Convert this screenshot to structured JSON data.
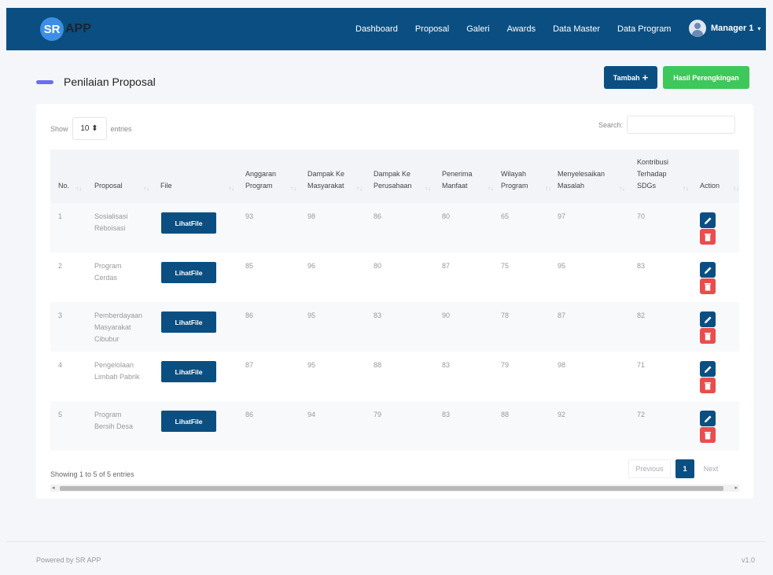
{
  "brand": {
    "logo": "SR",
    "text": "APP"
  },
  "nav": {
    "links": [
      "Dashboard",
      "Proposal",
      "Galeri",
      "Awards",
      "Data Master",
      "Data Program"
    ],
    "user": "Manager 1",
    "caret": "▾"
  },
  "header": {
    "title": "Penilaian Proposal",
    "add_label": "Tambah",
    "add_icon": "+",
    "ranking_label": "Hasil Perengkingan"
  },
  "table_controls": {
    "show_label": "Show",
    "entries_value": "10 ⬍",
    "entries_label": "entries",
    "search_label": "Search:"
  },
  "columns": [
    [
      "No."
    ],
    [
      "Proposal"
    ],
    [
      "File"
    ],
    [
      "Anggaran",
      "Program"
    ],
    [
      "Dampak Ke",
      "Masyarakat"
    ],
    [
      "Dampak Ke",
      "Perusahaan"
    ],
    [
      "Penerima",
      "Manfaat"
    ],
    [
      "Wilayah",
      "Program"
    ],
    [
      "Menyelesaikan",
      "Masalah"
    ],
    [
      "Kontribusi",
      "Terhadap",
      "SDGs"
    ],
    [
      "Action"
    ]
  ],
  "sort_icon": "↑↓",
  "file_button_label": "LihatFile",
  "rows": [
    {
      "no": "1",
      "proposal": [
        "Sosialisasi",
        "Reboisasi"
      ],
      "scores": [
        "93",
        "98",
        "86",
        "80",
        "65",
        "97",
        "70"
      ]
    },
    {
      "no": "2",
      "proposal": [
        "Program",
        "Cerdas"
      ],
      "scores": [
        "85",
        "96",
        "80",
        "87",
        "75",
        "95",
        "83"
      ]
    },
    {
      "no": "3",
      "proposal": [
        "Pemberdayaan",
        "Masyarakat",
        "Cibubur"
      ],
      "scores": [
        "86",
        "95",
        "83",
        "90",
        "78",
        "87",
        "82"
      ]
    },
    {
      "no": "4",
      "proposal": [
        "Pengelolaan",
        "Limbah Pabrik"
      ],
      "scores": [
        "87",
        "95",
        "88",
        "83",
        "79",
        "98",
        "71"
      ]
    },
    {
      "no": "5",
      "proposal": [
        "Program",
        "Bersih Desa"
      ],
      "scores": [
        "86",
        "94",
        "79",
        "83",
        "88",
        "92",
        "72"
      ]
    }
  ],
  "table_info": "Showing 1 to 5 of 5 entries",
  "pagination": {
    "previous": "Previous",
    "current": "1",
    "next": "Next"
  },
  "scroll_arrows": {
    "left": "◂",
    "right": "▸"
  },
  "footer": {
    "left": "Powered by SR APP",
    "right": "v1.0"
  }
}
